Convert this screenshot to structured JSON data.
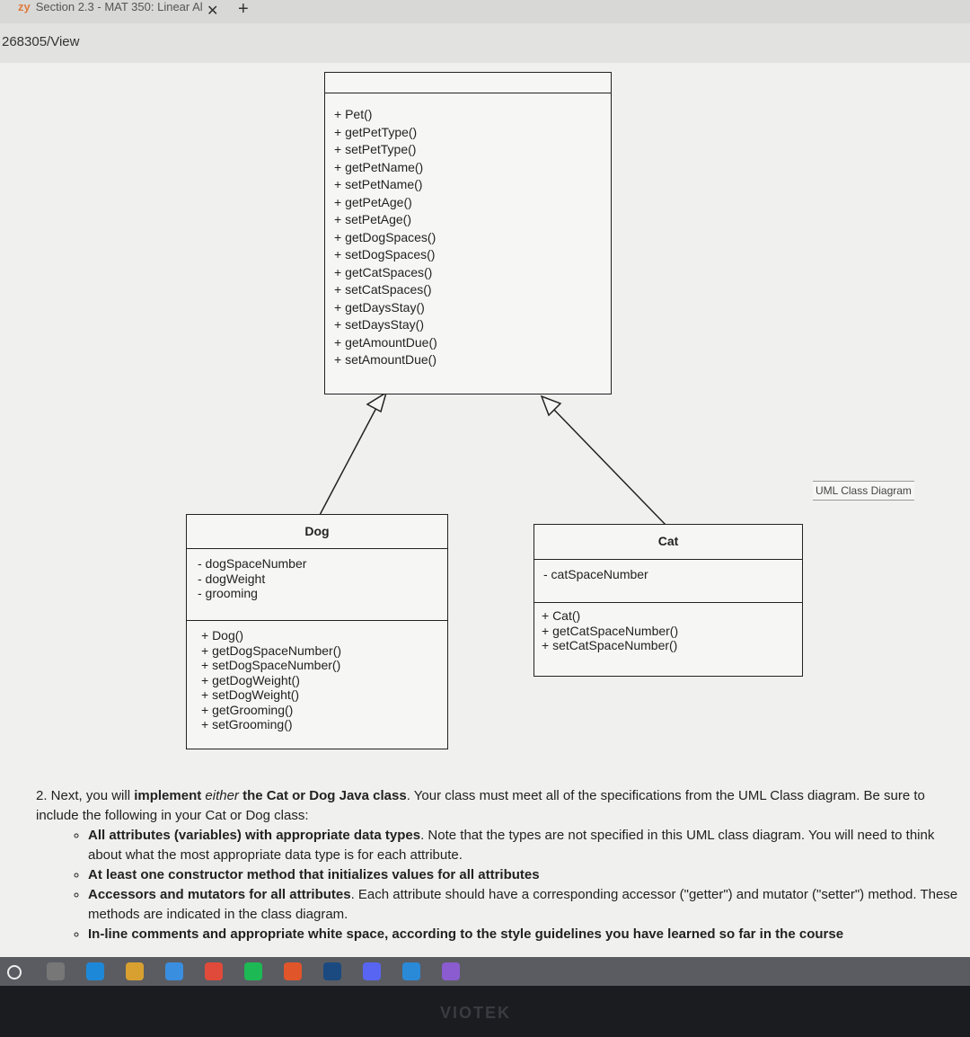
{
  "browser": {
    "tab_title": "Section 2.3 - MAT 350: Linear Al",
    "tab_logo": "zy",
    "url": "268305/View",
    "close_icon": "close-icon",
    "new_tab_icon": "plus-icon"
  },
  "diagram": {
    "label": "UML Class Diagram",
    "pet": {
      "name": "",
      "methods": [
        "+ Pet()",
        "+ getPetType()",
        "+ setPetType()",
        "+ getPetName()",
        "+ setPetName()",
        "+ getPetAge()",
        "+ setPetAge()",
        "+ getDogSpaces()",
        "+ setDogSpaces()",
        "+ getCatSpaces()",
        "+ setCatSpaces()",
        "+ getDaysStay()",
        "+ setDaysStay()",
        "+ getAmountDue()",
        "+ setAmountDue()"
      ]
    },
    "dog": {
      "name": "Dog",
      "attributes": [
        "- dogSpaceNumber",
        "- dogWeight",
        "- grooming"
      ],
      "methods": [
        "+ Dog()",
        "+ getDogSpaceNumber()",
        "+ setDogSpaceNumber()",
        "+ getDogWeight()",
        "+ setDogWeight()",
        "+ getGrooming()",
        "+ setGrooming()"
      ]
    },
    "cat": {
      "name": "Cat",
      "attributes": [
        "- catSpaceNumber"
      ],
      "methods": [
        "+ Cat()",
        "+ getCatSpaceNumber()",
        "+ setCatSpaceNumber()"
      ]
    }
  },
  "instructions": {
    "p1": "2. Next, you will ",
    "p1_bold": "implement ",
    "p1_em": "either",
    "p1_bold2": " the Cat or Dog Java class",
    "p1_rest": ". Your class must meet all of the specifications from the UML Class diagram. Be sure to include the following in your Cat or Dog class:",
    "items": [
      {
        "bold": "All attributes (variables) with appropriate data types",
        "rest": ". Note that the types are not specified in this UML class diagram. You will need to think about what the most appropriate data type is for each attribute."
      },
      {
        "bold": "At least one constructor method that initializes values for all attributes",
        "rest": ""
      },
      {
        "bold": "Accessors and mutators for all attributes",
        "rest": ". Each attribute should have a corresponding accessor (\"getter\") and mutator (\"setter\") method. These methods are indicated in the class diagram."
      },
      {
        "bold": "In-line comments and appropriate white space, according to the style guidelines you have learned so far in the course",
        "rest": ""
      }
    ]
  },
  "taskbar": {
    "icons": [
      "search-icon",
      "task-view-icon",
      "edge-icon",
      "file-explorer-icon",
      "mail-icon",
      "chrome-icon",
      "spotify-icon",
      "office-icon",
      "steam-icon",
      "discord-icon",
      "vscode-icon",
      "visual-studio-icon"
    ],
    "brand": "VIOTEK"
  }
}
